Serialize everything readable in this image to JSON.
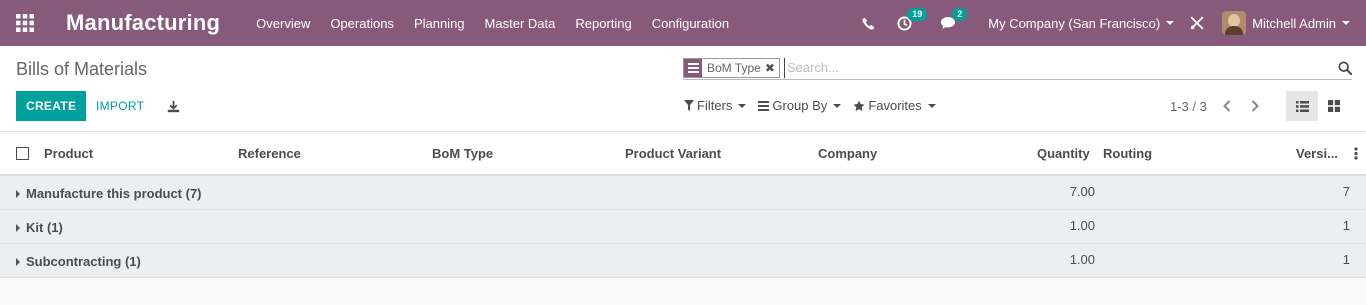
{
  "navbar": {
    "app_name": "Manufacturing",
    "menu": [
      "Overview",
      "Operations",
      "Planning",
      "Master Data",
      "Reporting",
      "Configuration"
    ],
    "activity_count": "19",
    "message_count": "2",
    "company": "My Company (San Francisco)",
    "user": "Mitchell Admin",
    "icons": [
      "apps-grid-icon",
      "phone-icon",
      "clock-icon",
      "chat-icon",
      "tools-icon"
    ]
  },
  "control_panel": {
    "title": "Bills of Materials",
    "facet_label": "BoM Type",
    "search_placeholder": "Search...",
    "create_label": "CREATE",
    "import_label": "IMPORT",
    "filters_label": "Filters",
    "groupby_label": "Group By",
    "favorites_label": "Favorites",
    "pager": "1-3 / 3"
  },
  "list": {
    "columns": [
      "Product",
      "Reference",
      "BoM Type",
      "Product Variant",
      "Company",
      "Quantity",
      "Routing",
      "Versi..."
    ],
    "groups": [
      {
        "name": "Manufacture this product (7)",
        "quantity": "7.00",
        "version": "7"
      },
      {
        "name": "Kit (1)",
        "quantity": "1.00",
        "version": "1"
      },
      {
        "name": "Subcontracting (1)",
        "quantity": "1.00",
        "version": "1"
      }
    ]
  },
  "colors": {
    "navbar": "#875a7b",
    "primary": "#00a09d",
    "group_row": "#eceff1"
  }
}
